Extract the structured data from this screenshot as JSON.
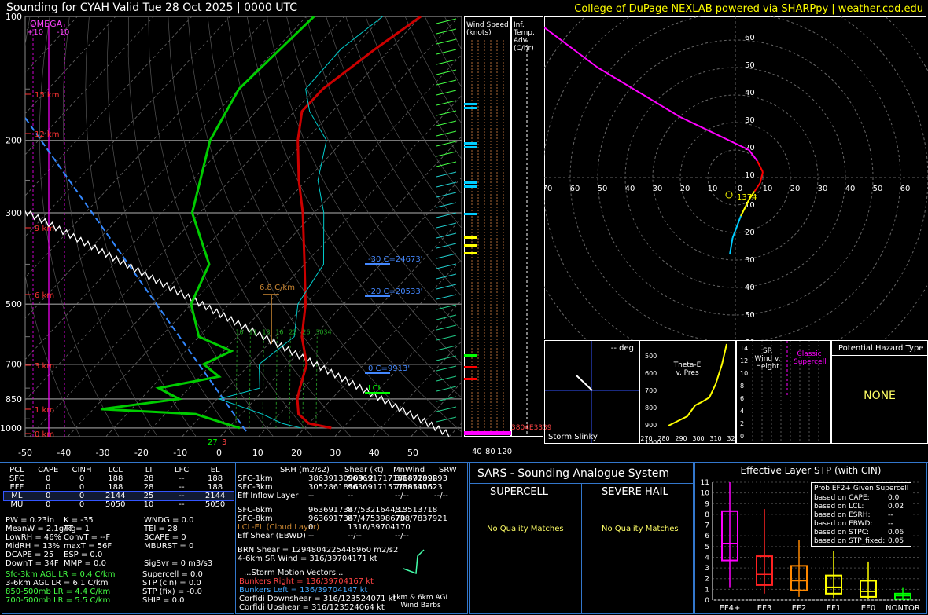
{
  "header": {
    "title": "Sounding for CYAH Valid  Tue 28 Oct 2025 | 0000 UTC",
    "credit": "College of DuPage NEXLAB powered via SHARPpy | weather.cod.edu"
  },
  "skewt": {
    "omega_label": "OMEGA",
    "omega_ticks": [
      "+10",
      "-10"
    ],
    "pressure_ticks": [
      "100",
      "200",
      "300",
      "500",
      "700",
      "850",
      "1000"
    ],
    "temp_ticks": [
      "-50",
      "-40",
      "-30",
      "-20",
      "-10",
      "0",
      "10",
      "20",
      "30",
      "40",
      "50"
    ],
    "height_labels": [
      "15 km",
      "12 km",
      "9 km",
      "6 km",
      "3 km",
      "1 km",
      "0 km"
    ],
    "lapse_label": "6.8 C/km",
    "isotherm_labels": [
      {
        "text": "-30 C=24673'",
        "color": "#4488ff"
      },
      {
        "text": "-20 C=20533'",
        "color": "#4488ff"
      },
      {
        "text": "0 C=9913'",
        "color": "#4488ff"
      },
      {
        "text": "LCL",
        "color": "#00ff00"
      }
    ],
    "mixing_labels": [
      "10",
      "11",
      "13",
      "16",
      "22",
      "26",
      "3034"
    ],
    "sfc_temp_label": "27",
    "sfc_dew_label": "3"
  },
  "wind_speed_panel": {
    "title": "Wind Speed (knots)",
    "ticks": [
      "40",
      "80",
      "120"
    ]
  },
  "inf_temp_panel": {
    "title": "Inf. Temp. Adv. (C/hr)",
    "bottom_label": "3804E3339"
  },
  "hodograph": {
    "x_ticks": [
      "70",
      "60",
      "50",
      "40",
      "30",
      "20",
      "10",
      "0",
      "10",
      "20",
      "30",
      "40",
      "50",
      "60",
      "70",
      "8"
    ],
    "y_ticks_up": [
      "60",
      "50",
      "40",
      "30",
      "20",
      "10"
    ],
    "y_ticks_down": [
      "10",
      "20",
      "30",
      "40",
      "50",
      "60"
    ],
    "storm_label": "1374"
  },
  "storm_slinky": {
    "title": "-- deg",
    "label": "Storm Slinky"
  },
  "theta_panel": {
    "label": "Theta-E v. Pres",
    "y_ticks": [
      "500",
      "600",
      "700",
      "800",
      "900",
      "1000"
    ],
    "x_ticks": [
      "270",
      "280",
      "290",
      "300",
      "310",
      "320"
    ]
  },
  "srwind_panel": {
    "label": "SR Wind v. Height",
    "y_ticks": [
      "14",
      "12",
      "10",
      "8",
      "6",
      "4",
      "2",
      "0"
    ],
    "classic_label": "Classic Supercell"
  },
  "hazard": {
    "title": "Potential Hazard Type",
    "value": "NONE"
  },
  "parcels": {
    "headers": [
      "PCL",
      "CAPE",
      "CINH",
      "LCL",
      "LI",
      "LFC",
      "EL"
    ],
    "rows": [
      [
        "SFC",
        "0",
        "0",
        "188",
        "28",
        "--",
        "188"
      ],
      [
        "EFF",
        "0",
        "0",
        "188",
        "28",
        "--",
        "188"
      ],
      [
        "ML",
        "0",
        "0",
        "2144",
        "25",
        "--",
        "2144"
      ],
      [
        "MU",
        "0",
        "0",
        "5050",
        "10",
        "--",
        "5050"
      ]
    ]
  },
  "indices": [
    [
      "PW = 0.23in",
      "K = -35",
      "WNDG = 0.0"
    ],
    [
      "MeanW = 2.1g/kg",
      "TT = 1",
      "TEI = 28"
    ],
    [
      "LowRH = 46%",
      "ConvT = --F",
      "3CAPE = 0"
    ],
    [
      "MidRH = 13%",
      "maxT = 56F",
      "MBURST = 0"
    ],
    [
      "DCAPE = 25",
      "ESP = 0.0",
      ""
    ],
    [
      "DownT = 34F",
      "MMP = 0.0",
      "SigSvr = 0 m3/s3"
    ]
  ],
  "lapse_rates": [
    {
      "text": "Sfc-3km AGL LR = 0.4 C/km",
      "color": "#44ff44"
    },
    {
      "text": "3-6km AGL LR = 6.1 C/km",
      "color": "#ffffff"
    },
    {
      "text": "850-500mb LR = 4.4 C/km",
      "color": "#44ff44"
    },
    {
      "text": "700-500mb LR = 5.5 C/km",
      "color": "#44ff44"
    }
  ],
  "composite": [
    "Supercell = 0.0",
    "STP (cin) = 0.0",
    "STP (fix) = -0.0",
    "SHIP = 0.0"
  ],
  "kinematics": {
    "headers": [
      "SRH (m2/s2)",
      "Shear (kt)",
      "MnWind",
      "SRW"
    ],
    "rows": [
      {
        "label": "SFC-1km",
        "vals": [
          "3863913090912",
          "963691717186892928",
          "3/147189293",
          ""
        ],
        "color": "#ffffff"
      },
      {
        "label": "SFC-3km",
        "vals": [
          "3052861856",
          "963691715778851052",
          "7/39147623",
          ""
        ],
        "color": "#ffffff"
      },
      {
        "label": "Eff Inflow Layer",
        "vals": [
          "--",
          "--",
          "--/--",
          "--/--"
        ],
        "color": "#ffffff"
      },
      {
        "label": "SFC-6km",
        "vals": [
          "963691734",
          "87/532164437",
          "/13513718",
          ""
        ],
        "color": "#ffffff"
      },
      {
        "label": "SFC-8km",
        "vals": [
          "963691734",
          "87/475398670",
          "738/7837921",
          ""
        ],
        "color": "#ffffff"
      },
      {
        "label": "LCL-EL (Cloud Layer)",
        "vals": [
          "0",
          "1316/39704170",
          "",
          ""
        ],
        "color": "#cc8833"
      },
      {
        "label": "Eff Shear (EBWD)",
        "vals": [
          "--",
          "--/--",
          "--/--",
          ""
        ],
        "color": "#ffffff"
      },
      {
        "label": "BRN Shear = 1294804225446960 m2/s2",
        "vals": [],
        "color": "#ffffff"
      },
      {
        "label": "4-6km SR Wind = 316/39704171 kt",
        "vals": [],
        "color": "#ffffff"
      }
    ],
    "storm_motion_title": "...Storm Motion Vectors...",
    "motions": [
      {
        "text": "Bunkers Right = 136/39704167 kt",
        "color": "#ff4444"
      },
      {
        "text": "Bunkers Left = 136/39704147 kt",
        "color": "#44aaff"
      },
      {
        "text": "Corfidi Downshear = 316/123524071 kt",
        "color": "#ffffff"
      },
      {
        "text": "Corfidi Upshear = 316/123524064 kt",
        "color": "#ffffff"
      }
    ],
    "barb_label": "1km & 6km AGL Wind Barbs"
  },
  "sars": {
    "title": "SARS - Sounding Analogue System",
    "supercell_title": "SUPERCELL",
    "hail_title": "SEVERE HAIL",
    "supercell_text": "No Quality Matches",
    "hail_text": "No Quality Matches"
  },
  "stp": {
    "title": "Effective Layer STP (with CIN)",
    "y_ticks": [
      "11",
      "10",
      "9",
      "8",
      "7",
      "6",
      "5",
      "4",
      "3",
      "2",
      "1",
      "0"
    ],
    "categories": [
      "EF4+",
      "EF3",
      "EF2",
      "EF1",
      "EF0",
      "NONTOR"
    ],
    "legend_title": "Prob EF2+ Given Supercell",
    "legend_rows": [
      [
        "based on CAPE:",
        "0.0"
      ],
      [
        "based on LCL:",
        "0.02"
      ],
      [
        "based on ESRH:",
        "--"
      ],
      [
        "based on EBWD:",
        "--"
      ],
      [
        "based on STPC:",
        "0.06"
      ],
      [
        "based on STP_fixed:",
        "0.05"
      ]
    ]
  },
  "chart_data": {
    "type": "box",
    "title": "Effective Layer STP (with CIN)",
    "categories": [
      "EF4+",
      "EF3",
      "EF2",
      "EF1",
      "EF0",
      "NONTOR"
    ],
    "whisker_low": [
      1.2,
      0.6,
      0.3,
      0.2,
      0.1,
      0.0
    ],
    "q1": [
      3.7,
      1.4,
      0.9,
      0.6,
      0.3,
      0.1
    ],
    "median": [
      5.3,
      2.4,
      1.8,
      1.2,
      0.8,
      0.4
    ],
    "q3": [
      8.3,
      4.1,
      3.2,
      2.3,
      1.8,
      0.6
    ],
    "whisker_high": [
      11.0,
      8.5,
      5.6,
      4.6,
      3.6,
      1.2
    ],
    "colors": [
      "#ff00ff",
      "#ff2222",
      "#ff8800",
      "#ffff00",
      "#ffff00",
      "#00ff00"
    ],
    "ylim": [
      0,
      11
    ],
    "skewt_profiles": {
      "temperature": [
        [
          1000,
          27
        ],
        [
          975,
          20
        ],
        [
          925,
          15
        ],
        [
          850,
          11
        ],
        [
          800,
          9
        ],
        [
          700,
          5
        ],
        [
          600,
          -3
        ],
        [
          500,
          -10
        ],
        [
          400,
          -20
        ],
        [
          300,
          -33
        ],
        [
          250,
          -42
        ],
        [
          200,
          -52
        ],
        [
          170,
          -58
        ],
        [
          150,
          -58
        ],
        [
          120,
          -54
        ],
        [
          100,
          -50
        ]
      ],
      "dewpoint": [
        [
          1000,
          3
        ],
        [
          975,
          -2
        ],
        [
          925,
          -12
        ],
        [
          900,
          -38
        ],
        [
          850,
          -20
        ],
        [
          800,
          -28
        ],
        [
          750,
          -15
        ],
        [
          700,
          -22
        ],
        [
          650,
          -18
        ],
        [
          600,
          -30
        ],
        [
          500,
          -40
        ],
        [
          400,
          -45
        ],
        [
          300,
          -62
        ],
        [
          200,
          -75
        ],
        [
          150,
          -80
        ],
        [
          100,
          -78
        ]
      ],
      "hodograph": [
        [
          -2,
          -28
        ],
        [
          -1,
          -22
        ],
        [
          2,
          -14
        ],
        [
          5,
          -8
        ],
        [
          7,
          -5
        ],
        [
          9,
          -2
        ],
        [
          10,
          2
        ],
        [
          8,
          6
        ],
        [
          5,
          10
        ],
        [
          -20,
          22
        ],
        [
          -50,
          40
        ],
        [
          -70,
          55
        ]
      ]
    }
  }
}
